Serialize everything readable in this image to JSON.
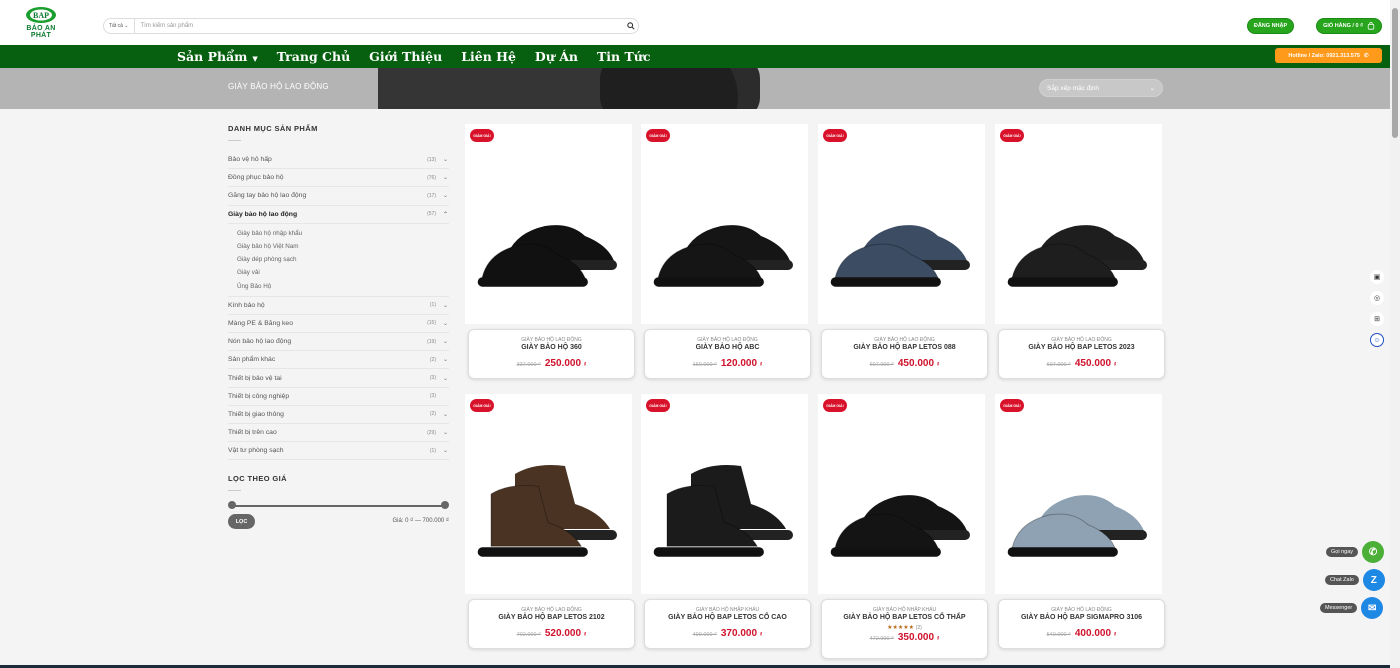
{
  "header": {
    "logo_text": "BẢO AN PHÁT",
    "search_category": "Tất cả",
    "search_placeholder": "Tìm kiếm sản phẩm",
    "login_label": "ĐĂNG NHẬP",
    "cart_label": "GIỎ HÀNG / 0 ₫",
    "hotline": "Hotline / Zalo: 0921.313.575"
  },
  "nav": [
    "Sản Phẩm",
    "Trang Chủ",
    "Giới Thiệu",
    "Liên Hệ",
    "Dự Án",
    "Tin Tức"
  ],
  "banner": {
    "title": "GIÀY BẢO HỘ LAO ĐỘNG",
    "sort": "Sắp xếp mặc định"
  },
  "sidebar": {
    "title": "DANH MỤC SẢN PHẨM",
    "categories": [
      {
        "label": "Bảo vệ hô hấp",
        "count": "(13)"
      },
      {
        "label": "Đồng phục bảo hộ",
        "count": "(76)"
      },
      {
        "label": "Găng tay bảo hộ lao động",
        "count": "(17)"
      },
      {
        "label": "Giày bảo hộ lao động",
        "count": "(57)"
      },
      {
        "label": "Kính bảo hộ",
        "count": "(1)"
      },
      {
        "label": "Màng PE & Băng keo",
        "count": "(15)"
      },
      {
        "label": "Nón bảo hộ lao động",
        "count": "(19)"
      },
      {
        "label": "Sản phẩm khác",
        "count": "(2)"
      },
      {
        "label": "Thiết bị bảo vệ tai",
        "count": "(3)"
      },
      {
        "label": "Thiết bị công nghiệp",
        "count": "(3)"
      },
      {
        "label": "Thiết bị giao thông",
        "count": "(2)"
      },
      {
        "label": "Thiết bị trên cao",
        "count": "(29)"
      },
      {
        "label": "Vật tư phòng sạch",
        "count": "(1)"
      }
    ],
    "subcategories": [
      "Giày bảo hộ nhập khẩu",
      "Giày bảo hộ Việt Nam",
      "Giày dép phòng sạch",
      "Giày vải",
      "Ủng Bảo Hộ"
    ],
    "price_title": "LỌC THEO GIÁ",
    "filter_button": "LỌC",
    "price_range": "Giá: 0 ₫ — 700.000 ₫"
  },
  "badge": "GIẢM GIÁ!",
  "currency": "₫",
  "products": [
    {
      "category": "GIÀY BẢO HỘ LAO ĐỘNG",
      "name": "GIÀY BẢO HỘ 360",
      "old_price": "337.000 ₫",
      "price": "250.000",
      "color": "#111"
    },
    {
      "category": "GIÀY BẢO HỘ LAO ĐỘNG",
      "name": "GIÀY BẢO HỘ ABC",
      "old_price": "160.000 ₫",
      "price": "120.000",
      "color": "#151515"
    },
    {
      "category": "GIÀY BẢO HỘ LAO ĐỘNG",
      "name": "GIÀY BẢO HỘ BAP LETOS 088",
      "old_price": "607.000 ₫",
      "price": "450.000",
      "color": "#3c4c63"
    },
    {
      "category": "GIÀY BẢO HỘ LAO ĐỘNG",
      "name": "GIÀY BẢO HỘ BAP LETOS 2023",
      "old_price": "607.000 ₫",
      "price": "450.000",
      "color": "#1e1e1e"
    },
    {
      "category": "GIÀY BẢO HỘ LAO ĐỘNG",
      "name": "GIÀY BẢO HỘ BAP LETOS 2102",
      "old_price": "702.000 ₫",
      "price": "520.000",
      "color": "#4a3322"
    },
    {
      "category": "GIÀY BẢO HỘ NHẬP KHẨU",
      "name": "GIÀY BẢO HỘ BAP LETOS CỔ CAO",
      "old_price": "499.000 ₫",
      "price": "370.000",
      "color": "#1b1b1b"
    },
    {
      "category": "GIÀY BẢO HỘ NHẬP KHẨU",
      "name": "GIÀY BẢO HỘ BAP LETOS CỔ THẤP",
      "old_price": "472.000 ₫",
      "price": "350.000",
      "color": "#141414",
      "stars": "★★★★★",
      "reviews": "(2)"
    },
    {
      "category": "GIÀY BẢO HỘ LAO ĐỘNG",
      "name": "GIÀY BẢO HỘ BAP SIGMAPRO 3106",
      "old_price": "540.000 ₫",
      "price": "400.000",
      "color": "#8ea2b4"
    }
  ],
  "float": {
    "call": "Gọi ngay",
    "zalo": "Chat Zalo",
    "messenger": "Messenger"
  },
  "colors": {
    "brand_green": "#06600f",
    "button_green": "#27a51d",
    "hotline_orange": "#ff9a1a",
    "sale_red": "#d9122b"
  }
}
